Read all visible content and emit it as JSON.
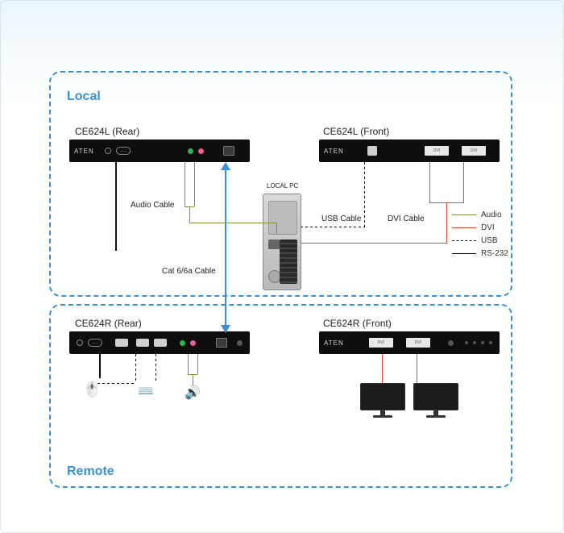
{
  "zones": {
    "local": {
      "label": "Local"
    },
    "remote": {
      "label": "Remote"
    }
  },
  "devices": {
    "local_rear": {
      "title": "CE624L (Rear)",
      "brand": "ATEN"
    },
    "local_front": {
      "title": "CE624L (Front)",
      "brand": "ATEN"
    },
    "remote_rear": {
      "title": "CE624R (Rear)",
      "brand": "ATEN"
    },
    "remote_front": {
      "title": "CE624R (Front)",
      "brand": "ATEN"
    }
  },
  "pc": {
    "label": "LOCAL PC"
  },
  "cables": {
    "audio": {
      "label": "Audio Cable"
    },
    "usb": {
      "label": "USB Cable"
    },
    "dvi": {
      "label": "DVI Cable"
    },
    "cat": {
      "label": "Cat 6/6a Cable"
    }
  },
  "legend": {
    "audio": "Audio",
    "dvi": "DVI",
    "usb": "USB",
    "rs232": "RS-232"
  }
}
